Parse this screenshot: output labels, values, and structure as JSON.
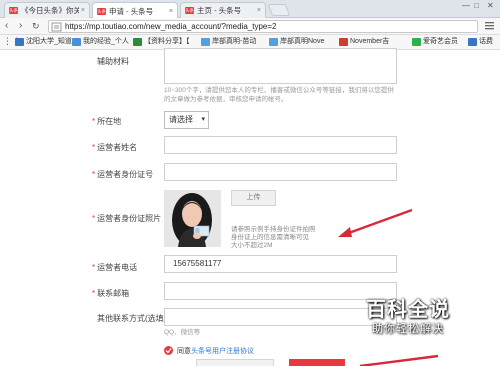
{
  "browser": {
    "tabs": [
      {
        "favicon": "toutiao",
        "title": "《今日头条》你关心",
        "active": false
      },
      {
        "favicon": "toutiao",
        "title": "申请 - 头条号",
        "active": true
      },
      {
        "favicon": "toutiao",
        "title": "主页 - 头条号",
        "active": false
      }
    ],
    "url": "https://mp.toutiao.com/new_media_account/?media_type=2",
    "bookmarks": [
      {
        "label": "沈阳大学_知道",
        "color": "#3b72c4"
      },
      {
        "label": "我的经验_个人",
        "color": "#4c8edb"
      },
      {
        "label": "【资料分享】【",
        "color": "#2d8b3a"
      },
      {
        "label": "岸部真明-苗动",
        "color": "#5a9fd8"
      },
      {
        "label": "岸部真明Nove",
        "color": "#5a9fd8"
      },
      {
        "label": "November吉",
        "color": "#d23b2f"
      },
      {
        "label": "爱奇艺会员",
        "color": "#2db24a"
      },
      {
        "label": "话费",
        "color": "#3b72c4"
      }
    ]
  },
  "form": {
    "aux_material_label": "辅助材料",
    "aux_material_hint": "10~300个字，请提供您本人的专栏、播客或微信公众号等链接，我们将以您提供的文章做为参考依据，审核您申请的帐号。",
    "location_label": "所在地",
    "location_select": "请选择",
    "operator_name_label": "运营者姓名",
    "operator_id_label": "运营者身份证号",
    "operator_id_photo_label": "运营者身份证照片",
    "upload_button": "上传",
    "photo_note_1": "请参照示例手持身份证件拍照",
    "photo_note_2": "身份证上的信息需清晰可见",
    "photo_note_3": "大小不超过2M",
    "operator_phone_label": "运营者电话",
    "operator_phone_value": "15675581177",
    "email_label": "联系邮箱",
    "other_contact_label": "其他联系方式(选填)",
    "other_contact_hint": "QQ、微信等",
    "agree_text": "同意",
    "agree_link": "头条号用户注册协议",
    "required_mark": "*"
  },
  "watermark": {
    "title": "百科全说",
    "subtitle": "助你轻松解决"
  },
  "colors": {
    "accent": "#e8383d",
    "arrow": "#d8293a",
    "link": "#2e7bd1"
  }
}
